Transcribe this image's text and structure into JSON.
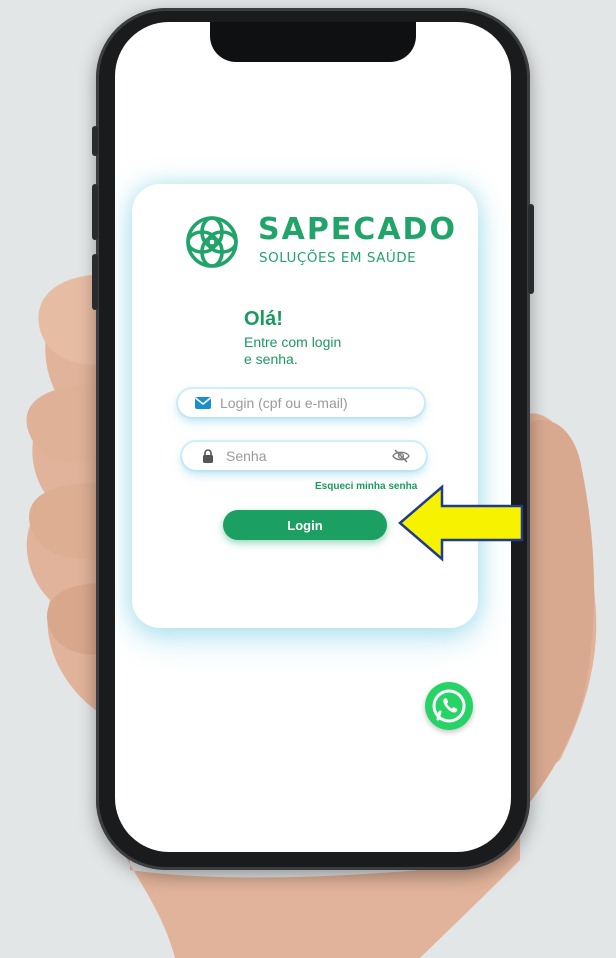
{
  "brand": {
    "name": "SAPECADO",
    "tagline": "SOLUÇÕES EM SAÚDE",
    "color": "#21a46a"
  },
  "greeting": {
    "title": "Olá!",
    "line1": "Entre com login",
    "line2": "e senha."
  },
  "form": {
    "login_placeholder": "Login (cpf ou e-mail)",
    "password_placeholder": "Senha",
    "forgot_label": "Esqueci minha senha",
    "submit_label": "Login"
  },
  "icons": {
    "login": "envelope-icon",
    "password": "lock-icon",
    "toggle": "eye-off-icon",
    "chat": "whatsapp-icon",
    "pointer": "arrow-left-icon"
  },
  "colors": {
    "accent": "#1c9f63",
    "whatsapp": "#27d367",
    "arrow_fill": "#f7f200",
    "arrow_stroke": "#1f3b8a"
  }
}
